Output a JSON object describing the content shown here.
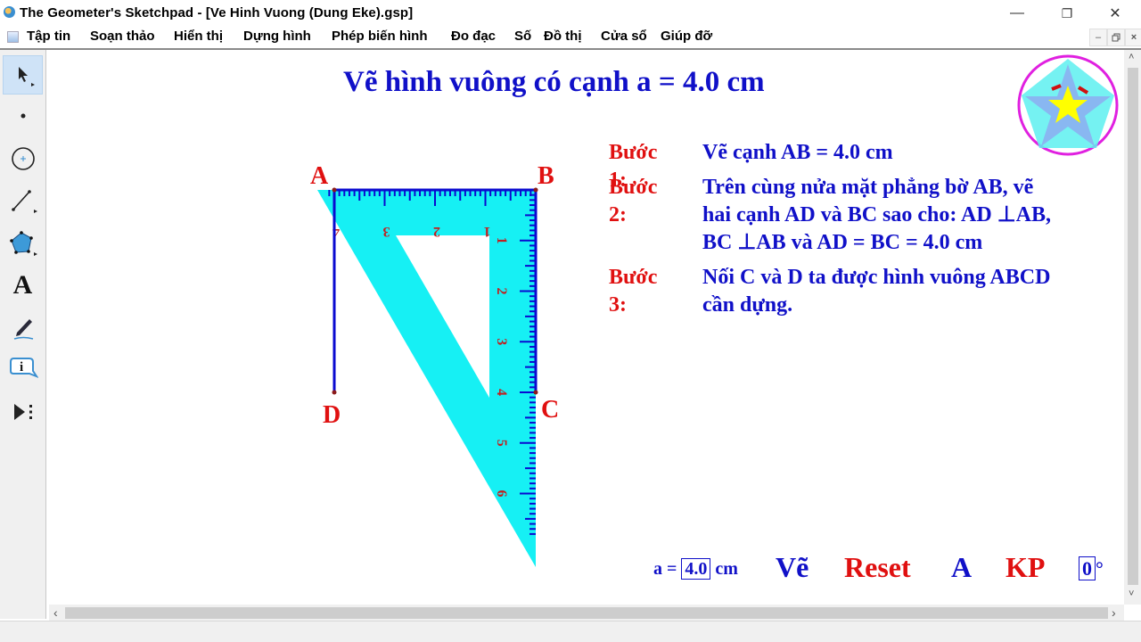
{
  "window": {
    "title": "The Geometer's Sketchpad - [Ve Hinh Vuong (Dung Eke).gsp]",
    "controls": {
      "minimize": "—",
      "restore": "❐",
      "close": "✕"
    },
    "mdi_controls": {
      "minimize": "‒",
      "restore": "🗗",
      "close": "×"
    }
  },
  "menubar": {
    "items": [
      "Tập tin",
      "Soạn thảo",
      "Hiển thị",
      "Dựng hình",
      "Phép biến hình",
      "Đo đạc",
      "Số",
      "Đồ thị",
      "Cửa sổ",
      "Giúp đỡ"
    ]
  },
  "toolbox": {
    "tools": [
      {
        "name": "arrow-select-tool",
        "active": true
      },
      {
        "name": "point-tool"
      },
      {
        "name": "compass-tool"
      },
      {
        "name": "straightedge-tool"
      },
      {
        "name": "polygon-tool"
      },
      {
        "name": "text-tool",
        "glyph": "A"
      },
      {
        "name": "marker-tool"
      },
      {
        "name": "information-tool",
        "glyph": "i"
      },
      {
        "name": "custom-tool"
      }
    ]
  },
  "sketch": {
    "title": "Vẽ hình vuông có cạnh a = 4.0 cm",
    "steps": [
      {
        "label": "Bước 1:",
        "lines": [
          "Vẽ cạnh AB = 4.0 cm"
        ]
      },
      {
        "label": "Bước 2:",
        "lines": [
          "Trên cùng nửa mặt phẳng bờ AB, vẽ",
          "hai cạnh AD và BC sao cho: AD ⊥AB,",
          "BC ⊥AB và AD = BC =  4.0 cm"
        ]
      },
      {
        "label": "Bước 3:",
        "lines": [
          "Nối C và D ta được hình vuông ABCD",
          "cần dựng."
        ]
      }
    ],
    "points": {
      "A": "A",
      "B": "B",
      "C": "C",
      "D": "D"
    },
    "ruler_top_labels": [
      "4",
      "3",
      "2",
      "1"
    ],
    "ruler_side_labels": [
      "1",
      "2",
      "3",
      "4",
      "5",
      "6"
    ],
    "colors": {
      "set_square": "#16f0f4",
      "segment": "#0a0ad0",
      "label": "#e01010",
      "text": "#1010c8"
    }
  },
  "controls": {
    "a_label": "a =",
    "a_value": "4.0",
    "a_unit": "cm",
    "draw_button": "Vẽ",
    "reset_button": "Reset",
    "hide_button": "A",
    "restore_button": "KP",
    "angle_value": "0",
    "angle_unit": "°"
  },
  "scroll": {
    "up": "˄",
    "down": "˅",
    "left": "‹",
    "right": "›"
  }
}
